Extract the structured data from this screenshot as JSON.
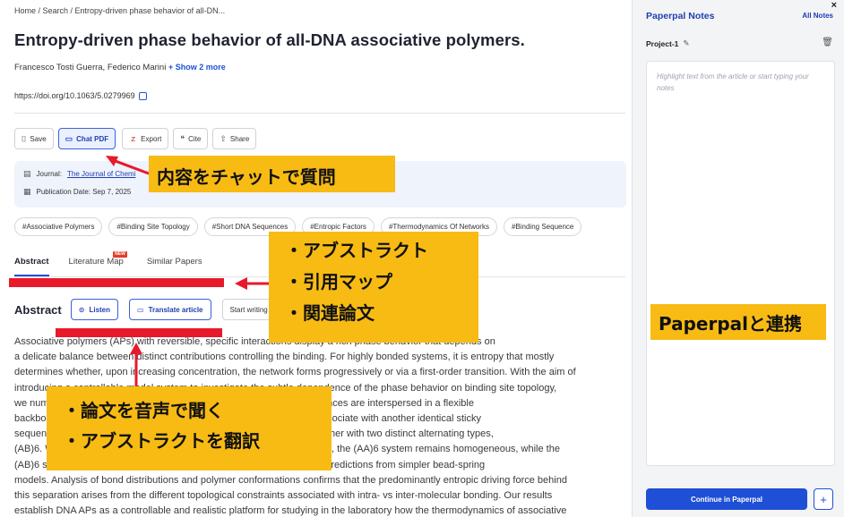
{
  "article": {
    "breadcrumb": "Home / Search / Entropy-driven phase behavior of all-DN...",
    "title": "Entropy-driven phase behavior of all-DNA associative polymers.",
    "authors": "Francesco Tosti Guerra, Federico Marini",
    "show_more": "+ Show 2 more",
    "doi": "https://doi.org/10.1063/5.0279969",
    "toolbar": {
      "save": "Save",
      "chat_pdf": "Chat PDF",
      "export": "Export",
      "cite": "Cite",
      "share": "Share"
    },
    "meta": {
      "journal_label": "Journal:",
      "journal_value": "The Journal of Chemi",
      "date_label": "Publication Date: Sep 7, 2025"
    },
    "tags": [
      "#Associative Polymers",
      "#Binding Site Topology",
      "#Short DNA Sequences",
      "#Entropic Factors",
      "#Thermodynamics Of Networks",
      "#Binding Sequence"
    ],
    "tabs": {
      "abstract": "Abstract",
      "literature_map": "Literature Map",
      "new_badge": "NEW",
      "similar_papers": "Similar Papers"
    },
    "abstract_section": {
      "heading": "Abstract",
      "listen": "Listen",
      "translate": "Translate article",
      "start_writing": "Start writing"
    },
    "abstract_lines": [
      "Associative polymers (APs) with reversible, specific interactions display a rich phase behavior that depends on",
      "a delicate balance between distinct contributions controlling the binding. For highly bonded systems, it is entropy that mostly",
      "determines whether, upon increasing concentration, the network forms progressively or via a first-order transition. With the aim of",
      "introducing a controllable model system to investigate the subtle dependence of the phase behavior on binding site topology,",
      "we numerically investigate DNA-based APs formed by short DNA sequences are interspersed in a flexible",
      "backbone, each DNA associative site of which binding sequence can associate with another identical sticky",
      "sequence. We consider two systems of the same type, (AA)6, and the other with two distinct alternating types,",
      "(AB)6. While every site can form a bond with any other site within a bond, the (AA)6 system remains homogeneous, while the",
      "(AB)6 system phase separates as a result of entropic factors, mirroring predictions from simpler bead-spring",
      "models. Analysis of bond distributions and polymer conformations confirms that the predominantly entropic driving force behind",
      "this separation arises from the different topological constraints associated with intra- vs inter-molecular bonding. Our results",
      "establish DNA APs as a controllable and realistic platform for studying in the laboratory how the thermodynamics of associative"
    ]
  },
  "notes": {
    "title": "Paperpal Notes",
    "close": "×",
    "all_notes": "All Notes",
    "project": "Project-1",
    "placeholder": "Highlight text from the article or start typing your notes",
    "continue": "Continue in Paperpal",
    "plus": "+"
  },
  "annotations": {
    "chat": "内容をチャットで質問",
    "tabs_lines": [
      "・アブストラクト",
      "・引用マップ",
      "・関連論文"
    ],
    "paperpal": "Paperpalと連携",
    "audio_lines": [
      "・論文を音声で聞く",
      "・アブストラクトを翻訳"
    ],
    "accent_color": "#f7bb14",
    "arrow_color": "#e8192b"
  }
}
